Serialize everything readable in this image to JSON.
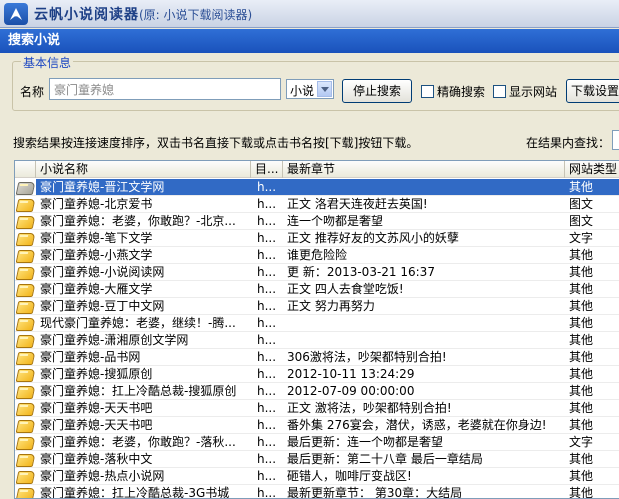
{
  "app": {
    "title": "云帆小说阅读器",
    "subtitle": "(原: 小说下载阅读器)"
  },
  "dialog": {
    "title": "搜索小说"
  },
  "basic_info": {
    "legend": "基本信息",
    "name_label": "名称",
    "search_value": "豪门童养媳",
    "type_value": "小说",
    "stop_button": "停止搜索",
    "exact_search": "精确搜索",
    "show_site": "显示网站",
    "download_settings": "下载设置"
  },
  "hint": "搜索结果按连接速度排序，双击书名直接下载或点击书名按[下载]按钮下载。",
  "in_results_label": "在结果内查找：",
  "table": {
    "columns": [
      "小说名称",
      "目...",
      "最新章节",
      "网站类型"
    ],
    "rows": [
      {
        "name": "豪门童养媳-晋江文学网",
        "dir": "h...",
        "latest": "",
        "type": "其他",
        "selected": true
      },
      {
        "name": "豪门童养媳-北京爱书",
        "dir": "h...",
        "latest": "正文 洛君天连夜赶去英国!",
        "type": "图文"
      },
      {
        "name": "豪门童养媳：老婆，你敢跑？-北京...",
        "dir": "h...",
        "latest": "连一个吻都是奢望",
        "type": "图文"
      },
      {
        "name": "豪门童养媳-笔下文学",
        "dir": "h...",
        "latest": "正文 推荐好友的文苏风小的妖孽",
        "type": "文字"
      },
      {
        "name": "豪门童养媳-小燕文学",
        "dir": "h...",
        "latest": "谁更危险险",
        "type": "其他"
      },
      {
        "name": "豪门童养媳-小说阅读网",
        "dir": "h...",
        "latest": "更   新：2013-03-21 16:37",
        "type": "其他"
      },
      {
        "name": "豪门童养媳-大雁文学",
        "dir": "h...",
        "latest": "正文 四人去食堂吃饭!",
        "type": "其他"
      },
      {
        "name": "豪门童养媳-豆丁中文网",
        "dir": "h...",
        "latest": "正文 努力再努力",
        "type": "其他"
      },
      {
        "name": "现代豪门童养媳：老婆，继续！-腾...",
        "dir": "h...",
        "latest": "",
        "type": "其他"
      },
      {
        "name": "豪门童养媳-潇湘原创文学网",
        "dir": "h...",
        "latest": "",
        "type": "其他"
      },
      {
        "name": "豪门童养媳-品书网",
        "dir": "h...",
        "latest": "306激将法，吵架都特别合拍!",
        "type": "其他"
      },
      {
        "name": "豪门童养媳-搜狐原创",
        "dir": "h...",
        "latest": "2012-10-11 13:24:29",
        "type": "其他"
      },
      {
        "name": "豪门童养媳：扛上冷酷总裁-搜狐原创",
        "dir": "h...",
        "latest": "2012-07-09 00:00:00",
        "type": "其他"
      },
      {
        "name": "豪门童养媳-天天书吧",
        "dir": "h...",
        "latest": "正文 激将法，吵架都特别合拍!",
        "type": "其他"
      },
      {
        "name": "豪门童养媳-天天书吧",
        "dir": "h...",
        "latest": "番外集 276宴会，潜伏，诱惑，老婆就在你身边!",
        "type": "其他"
      },
      {
        "name": "豪门童养媳：老婆，你敢跑？-落秋...",
        "dir": "h...",
        "latest": "最后更新：连一个吻都是奢望",
        "type": "文字"
      },
      {
        "name": "豪门童养媳-落秋中文",
        "dir": "h...",
        "latest": "最后更新：第二十八章 最后一章结局",
        "type": "其他"
      },
      {
        "name": "豪门童养媳-热点小说网",
        "dir": "h...",
        "latest": "砸错人，咖啡厅变战区!",
        "type": "其他"
      },
      {
        "name": "豪门童养媳：扛上冷酷总裁-3G书城",
        "dir": "h...",
        "latest": "最新更新章节： 第30章：大结局",
        "type": "其他"
      }
    ]
  }
}
